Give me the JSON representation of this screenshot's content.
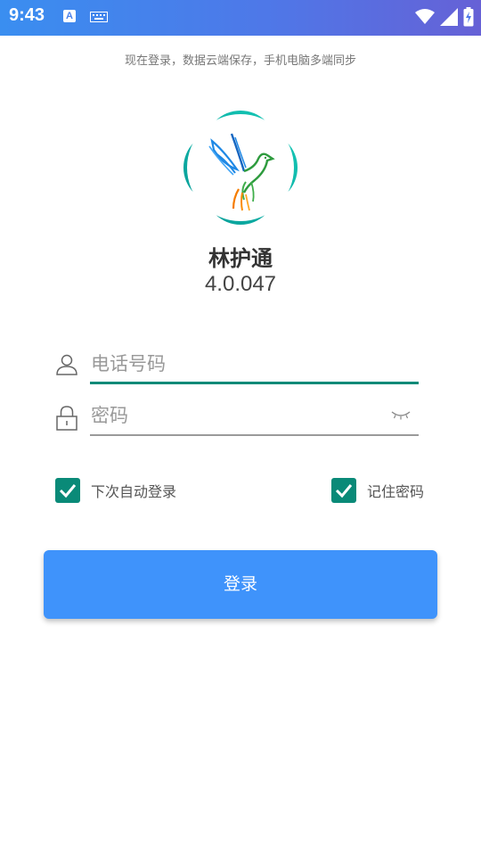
{
  "status_bar": {
    "time": "9:43",
    "icons": [
      "a-notification-icon",
      "keyboard-icon",
      "wifi-icon",
      "signal-icon",
      "battery-charging-icon"
    ]
  },
  "header": {
    "subtitle": "现在登录，数据云端保存，手机电脑多端同步"
  },
  "app": {
    "name": "林护通",
    "version": "4.0.047",
    "logo_icon": "dove-logo-icon"
  },
  "form": {
    "phone_placeholder": "电话号码",
    "password_placeholder": "密码",
    "phone_icon": "user-icon",
    "password_icon": "lock-icon",
    "toggle_icon": "eye-closed-icon"
  },
  "options": {
    "auto_login_label": "下次自动登录",
    "auto_login_checked": true,
    "remember_label": "记住密码",
    "remember_checked": true
  },
  "actions": {
    "login_label": "登录"
  },
  "colors": {
    "accent_teal": "#0a8a78",
    "button_blue": "#3f93fb",
    "status_gradient_start": "#3a8ef0",
    "status_gradient_end": "#6661d6"
  }
}
